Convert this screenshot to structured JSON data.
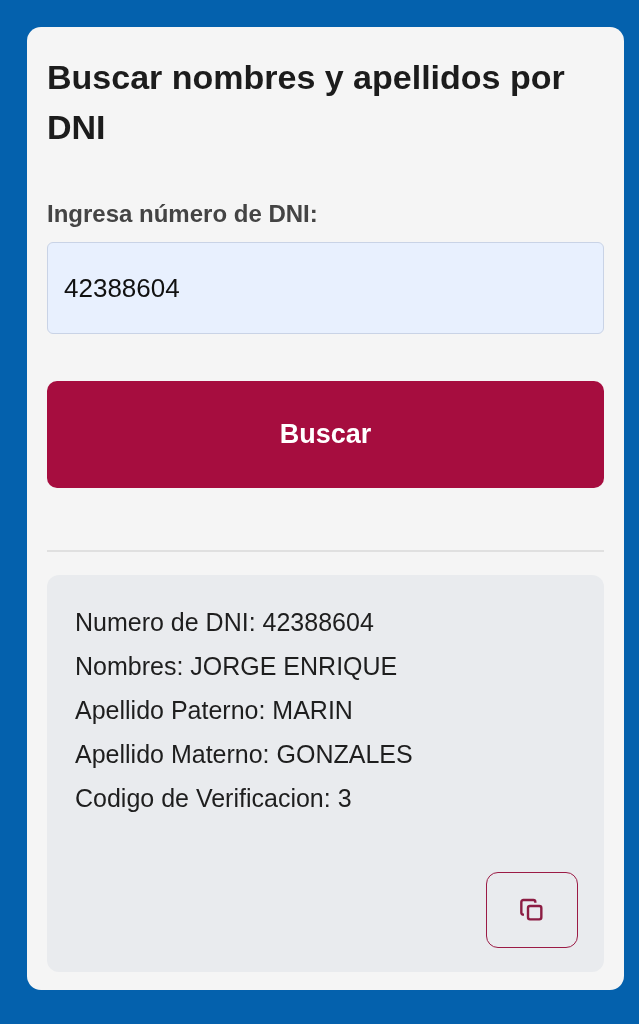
{
  "title": "Buscar nombres y apellidos por DNI",
  "dni_field": {
    "label": "Ingresa número de DNI:",
    "value": "42388604"
  },
  "search_button": {
    "label": "Buscar"
  },
  "result": {
    "lines": [
      "Numero de DNI: 42388604",
      "Nombres: JORGE ENRIQUE",
      "Apellido Paterno: MARIN",
      "Apellido Materno: GONZALES",
      "Codigo de Verificacion: 3"
    ]
  }
}
